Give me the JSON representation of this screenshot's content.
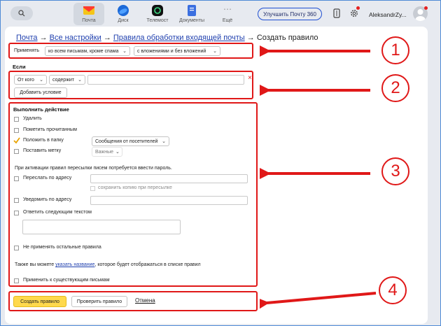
{
  "header": {
    "services": [
      {
        "label": "Почта",
        "icon": "mail-icon",
        "active": true
      },
      {
        "label": "Диск",
        "icon": "disk-icon",
        "active": false
      },
      {
        "label": "Телемост",
        "icon": "telemost-icon",
        "active": false
      },
      {
        "label": "Документы",
        "icon": "documents-icon",
        "active": false
      },
      {
        "label": "Ещё",
        "icon": "more-icon",
        "active": false
      }
    ],
    "upgrade_label": "Улучшить Почту 360",
    "username": "AleksandrZy..."
  },
  "breadcrumb": {
    "mail": "Почта",
    "sep": "→",
    "all_settings": "Все настройки",
    "rules": "Правила обработки входящей почты",
    "current": "Создать правило"
  },
  "apply": {
    "label": "Применять",
    "scope": "ко всем письмам, кроме спама",
    "attachments": "с вложениями и без вложений"
  },
  "condition": {
    "title": "Если",
    "field": "От кого",
    "operator": "содержит",
    "value": "",
    "remove_icon": "×",
    "add_button": "Добавить условие"
  },
  "actions": {
    "title": "Выполнить действие",
    "delete": "Удалить",
    "mark_read": "Пометить прочитанным",
    "move_to_folder": "Положить в папку",
    "folder_value": "Сообщения от посетителей",
    "set_label": "Поставить метку",
    "label_value": "Важные",
    "password_note": "При активации правил пересылки писем потребуется ввести пароль.",
    "forward": "Переслать по адресу",
    "forward_value": "",
    "keep_copy": "сохранить копию при пересылке",
    "notify": "Уведомить по адресу",
    "notify_value": "",
    "reply": "Ответить следующим текстом",
    "reply_text": "",
    "dont_apply_others": "Не применять остальные правила",
    "name_note_before": "Также вы можете",
    "name_note_link": "указать название",
    "name_note_after": ", которое будет отображаться в списке правил",
    "apply_existing": "Применить к существующим письмам"
  },
  "footer": {
    "create": "Создать правило",
    "check": "Проверить правило",
    "cancel": "Отмена"
  },
  "annotations": [
    "1",
    "2",
    "3",
    "4"
  ],
  "colors": {
    "accent_red": "#e01818",
    "primary_button": "#ffd94c",
    "link": "#1f3fae",
    "check": "#e8a300"
  }
}
